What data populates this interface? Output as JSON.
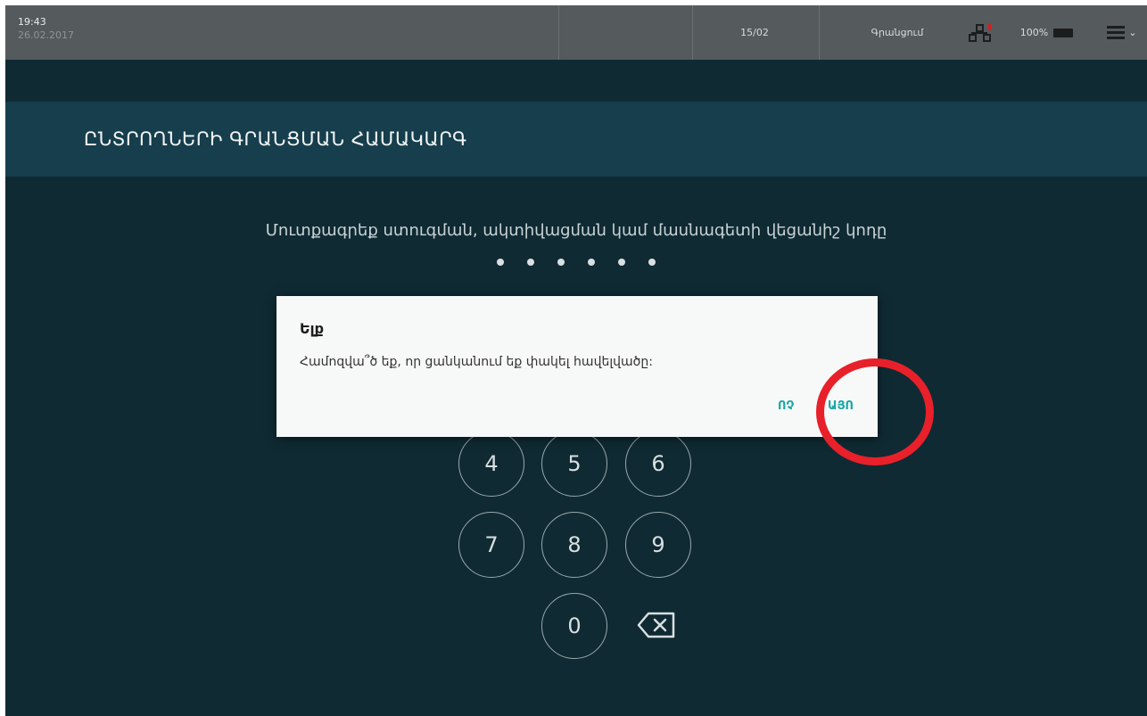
{
  "statusbar": {
    "time": "19:43",
    "date": "26.02.2017",
    "date_field": "15/02",
    "mode": "Գրանցում",
    "battery": "100%",
    "icons": [
      "network-icon",
      "battery-icon",
      "menu-icon",
      "chevron-down-icon"
    ]
  },
  "header": {
    "title": "ԸՆՏՐՈՂՆԵՐԻ ԳՐԱՆՑՄԱՆ ՀԱՄԱԿԱՐԳ"
  },
  "main": {
    "prompt": "Մուտքագրեք ստուգման, ակտիվացման կամ մասնագետի վեցանիշ կոդը",
    "pin_length": 6
  },
  "keypad": {
    "keys": [
      "4",
      "5",
      "6",
      "7",
      "8",
      "9",
      "0"
    ],
    "backspace_icon": "backspace-icon"
  },
  "dialog": {
    "title": "Ելք",
    "message": "Համոզվա՞ծ եք, որ ցանկանում եք փակել հավելվածը:",
    "no_label": "ՈՉ",
    "yes_label": "ԱՅՈ"
  },
  "colors": {
    "background": "#0f2a33",
    "header_strip": "#163e4c",
    "statusbar": "#555a5c",
    "accent": "#1aa6a6",
    "highlight": "#e8202a"
  }
}
